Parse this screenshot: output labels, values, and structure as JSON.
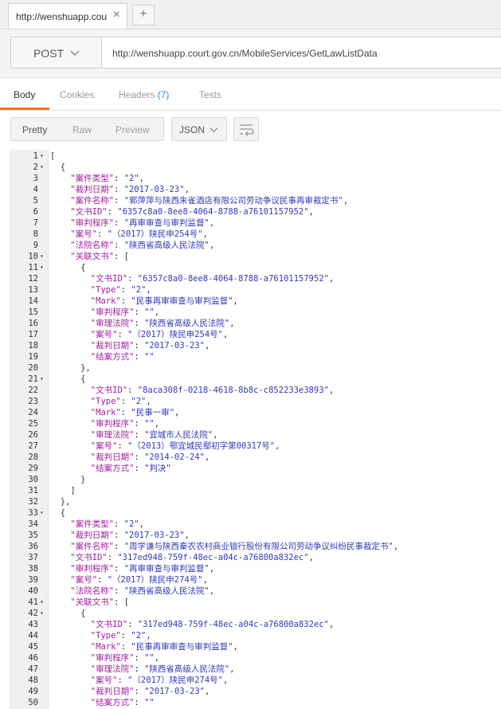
{
  "tab": {
    "title": "http://wenshuapp.court.gov.cn/MobileServices/GetLawListData",
    "close": "×",
    "new": "+"
  },
  "request": {
    "method": "POST",
    "url": "http://wenshuapp.court.gov.cn/MobileServices/GetLawListData"
  },
  "response_tabs": [
    {
      "label": "Body",
      "count": "",
      "active": true
    },
    {
      "label": "Cookies",
      "count": "",
      "active": false
    },
    {
      "label": "Headers",
      "count": "(7)",
      "active": false
    },
    {
      "label": "Tests",
      "count": "",
      "active": false
    }
  ],
  "view_modes": [
    "Pretty",
    "Raw",
    "Preview"
  ],
  "format": "JSON",
  "colors": {
    "key": "#a01fa0",
    "string": "#2f3bb8",
    "accent": "#f47023",
    "count": "#2a86d9"
  },
  "lines": [
    {
      "n": "1",
      "fold": true,
      "indent": 0,
      "pre": "[",
      "key": "",
      "mid": "",
      "val": "",
      "post": ""
    },
    {
      "n": "2",
      "fold": true,
      "indent": 2,
      "pre": "{",
      "key": "",
      "mid": "",
      "val": "",
      "post": ""
    },
    {
      "n": "3",
      "fold": false,
      "indent": 4,
      "pre": "",
      "key": "\"案件类型\"",
      "mid": ": ",
      "val": "\"2\"",
      "post": ","
    },
    {
      "n": "4",
      "fold": false,
      "indent": 4,
      "pre": "",
      "key": "\"裁判日期\"",
      "mid": ": ",
      "val": "\"2017-03-23\"",
      "post": ","
    },
    {
      "n": "5",
      "fold": false,
      "indent": 4,
      "pre": "",
      "key": "\"案件名称\"",
      "mid": ": ",
      "val": "\"郭萍萍与陕西朱雀酒店有限公司劳动争议民事再审裁定书\"",
      "post": ","
    },
    {
      "n": "6",
      "fold": false,
      "indent": 4,
      "pre": "",
      "key": "\"文书ID\"",
      "mid": ": ",
      "val": "\"6357c8a0-8ee8-4064-8788-a76101157952\"",
      "post": ","
    },
    {
      "n": "7",
      "fold": false,
      "indent": 4,
      "pre": "",
      "key": "\"审判程序\"",
      "mid": ": ",
      "val": "\"再审审查与审判监督\"",
      "post": ","
    },
    {
      "n": "8",
      "fold": false,
      "indent": 4,
      "pre": "",
      "key": "\"案号\"",
      "mid": ": ",
      "val": "\"（2017）陕民申254号\"",
      "post": ","
    },
    {
      "n": "9",
      "fold": false,
      "indent": 4,
      "pre": "",
      "key": "\"法院名称\"",
      "mid": ": ",
      "val": "\"陕西省高级人民法院\"",
      "post": ","
    },
    {
      "n": "10",
      "fold": true,
      "indent": 4,
      "pre": "",
      "key": "\"关联文书\"",
      "mid": ": [",
      "val": "",
      "post": ""
    },
    {
      "n": "11",
      "fold": true,
      "indent": 6,
      "pre": "{",
      "key": "",
      "mid": "",
      "val": "",
      "post": ""
    },
    {
      "n": "12",
      "fold": false,
      "indent": 8,
      "pre": "",
      "key": "\"文书ID\"",
      "mid": ": ",
      "val": "\"6357c8a0-8ee8-4064-8788-a76101157952\"",
      "post": ","
    },
    {
      "n": "13",
      "fold": false,
      "indent": 8,
      "pre": "",
      "key": "\"Type\"",
      "mid": ": ",
      "val": "\"2\"",
      "post": ","
    },
    {
      "n": "14",
      "fold": false,
      "indent": 8,
      "pre": "",
      "key": "\"Mark\"",
      "mid": ": ",
      "val": "\"民事再审审查与审判监督\"",
      "post": ","
    },
    {
      "n": "15",
      "fold": false,
      "indent": 8,
      "pre": "",
      "key": "\"审判程序\"",
      "mid": ": ",
      "val": "\"\"",
      "post": ","
    },
    {
      "n": "16",
      "fold": false,
      "indent": 8,
      "pre": "",
      "key": "\"审理法院\"",
      "mid": ": ",
      "val": "\"陕西省高级人民法院\"",
      "post": ","
    },
    {
      "n": "17",
      "fold": false,
      "indent": 8,
      "pre": "",
      "key": "\"案号\"",
      "mid": ": ",
      "val": "\"（2017）陕民申254号\"",
      "post": ","
    },
    {
      "n": "18",
      "fold": false,
      "indent": 8,
      "pre": "",
      "key": "\"裁判日期\"",
      "mid": ": ",
      "val": "\"2017-03-23\"",
      "post": ","
    },
    {
      "n": "19",
      "fold": false,
      "indent": 8,
      "pre": "",
      "key": "\"结案方式\"",
      "mid": ": ",
      "val": "\"\"",
      "post": ""
    },
    {
      "n": "20",
      "fold": false,
      "indent": 6,
      "pre": "},",
      "key": "",
      "mid": "",
      "val": "",
      "post": ""
    },
    {
      "n": "21",
      "fold": true,
      "indent": 6,
      "pre": "{",
      "key": "",
      "mid": "",
      "val": "",
      "post": ""
    },
    {
      "n": "22",
      "fold": false,
      "indent": 8,
      "pre": "",
      "key": "\"文书ID\"",
      "mid": ": ",
      "val": "\"8aca308f-0218-4618-8b8c-c852233e3893\"",
      "post": ","
    },
    {
      "n": "23",
      "fold": false,
      "indent": 8,
      "pre": "",
      "key": "\"Type\"",
      "mid": ": ",
      "val": "\"2\"",
      "post": ","
    },
    {
      "n": "24",
      "fold": false,
      "indent": 8,
      "pre": "",
      "key": "\"Mark\"",
      "mid": ": ",
      "val": "\"民事一审\"",
      "post": ","
    },
    {
      "n": "25",
      "fold": false,
      "indent": 8,
      "pre": "",
      "key": "\"审判程序\"",
      "mid": ": ",
      "val": "\"\"",
      "post": ","
    },
    {
      "n": "26",
      "fold": false,
      "indent": 8,
      "pre": "",
      "key": "\"审理法院\"",
      "mid": ": ",
      "val": "\"宜城市人民法院\"",
      "post": ","
    },
    {
      "n": "27",
      "fold": false,
      "indent": 8,
      "pre": "",
      "key": "\"案号\"",
      "mid": ": ",
      "val": "\"（2013）鄂宜城民鄢初字第00317号\"",
      "post": ","
    },
    {
      "n": "28",
      "fold": false,
      "indent": 8,
      "pre": "",
      "key": "\"裁判日期\"",
      "mid": ": ",
      "val": "\"2014-02-24\"",
      "post": ","
    },
    {
      "n": "29",
      "fold": false,
      "indent": 8,
      "pre": "",
      "key": "\"结案方式\"",
      "mid": ": ",
      "val": "\"判决\"",
      "post": ""
    },
    {
      "n": "30",
      "fold": false,
      "indent": 6,
      "pre": "}",
      "key": "",
      "mid": "",
      "val": "",
      "post": ""
    },
    {
      "n": "31",
      "fold": false,
      "indent": 4,
      "pre": "]",
      "key": "",
      "mid": "",
      "val": "",
      "post": ""
    },
    {
      "n": "32",
      "fold": false,
      "indent": 2,
      "pre": "},",
      "key": "",
      "mid": "",
      "val": "",
      "post": ""
    },
    {
      "n": "33",
      "fold": true,
      "indent": 2,
      "pre": "{",
      "key": "",
      "mid": "",
      "val": "",
      "post": ""
    },
    {
      "n": "34",
      "fold": false,
      "indent": 4,
      "pre": "",
      "key": "\"案件类型\"",
      "mid": ": ",
      "val": "\"2\"",
      "post": ","
    },
    {
      "n": "35",
      "fold": false,
      "indent": 4,
      "pre": "",
      "key": "\"裁判日期\"",
      "mid": ": ",
      "val": "\"2017-03-23\"",
      "post": ","
    },
    {
      "n": "36",
      "fold": false,
      "indent": 4,
      "pre": "",
      "key": "\"案件名称\"",
      "mid": ": ",
      "val": "\"周学谦与陕西秦农农村商业银行股份有限公司劳动争议纠纷民事裁定书\"",
      "post": ","
    },
    {
      "n": "37",
      "fold": false,
      "indent": 4,
      "pre": "",
      "key": "\"文书ID\"",
      "mid": ": ",
      "val": "\"317ed948-759f-48ec-a04c-a76800a832ec\"",
      "post": ","
    },
    {
      "n": "38",
      "fold": false,
      "indent": 4,
      "pre": "",
      "key": "\"审判程序\"",
      "mid": ": ",
      "val": "\"再审审查与审判监督\"",
      "post": ","
    },
    {
      "n": "39",
      "fold": false,
      "indent": 4,
      "pre": "",
      "key": "\"案号\"",
      "mid": ": ",
      "val": "\"（2017）陕民申274号\"",
      "post": ","
    },
    {
      "n": "40",
      "fold": false,
      "indent": 4,
      "pre": "",
      "key": "\"法院名称\"",
      "mid": ": ",
      "val": "\"陕西省高级人民法院\"",
      "post": ","
    },
    {
      "n": "41",
      "fold": true,
      "indent": 4,
      "pre": "",
      "key": "\"关联文书\"",
      "mid": ": [",
      "val": "",
      "post": ""
    },
    {
      "n": "42",
      "fold": true,
      "indent": 6,
      "pre": "{",
      "key": "",
      "mid": "",
      "val": "",
      "post": ""
    },
    {
      "n": "43",
      "fold": false,
      "indent": 8,
      "pre": "",
      "key": "\"文书ID\"",
      "mid": ": ",
      "val": "\"317ed948-759f-48ec-a04c-a76800a832ec\"",
      "post": ","
    },
    {
      "n": "44",
      "fold": false,
      "indent": 8,
      "pre": "",
      "key": "\"Type\"",
      "mid": ": ",
      "val": "\"2\"",
      "post": ","
    },
    {
      "n": "45",
      "fold": false,
      "indent": 8,
      "pre": "",
      "key": "\"Mark\"",
      "mid": ": ",
      "val": "\"民事再审审查与审判监督\"",
      "post": ","
    },
    {
      "n": "46",
      "fold": false,
      "indent": 8,
      "pre": "",
      "key": "\"审判程序\"",
      "mid": ": ",
      "val": "\"\"",
      "post": ","
    },
    {
      "n": "47",
      "fold": false,
      "indent": 8,
      "pre": "",
      "key": "\"审理法院\"",
      "mid": ": ",
      "val": "\"陕西省高级人民法院\"",
      "post": ","
    },
    {
      "n": "48",
      "fold": false,
      "indent": 8,
      "pre": "",
      "key": "\"案号\"",
      "mid": ": ",
      "val": "\"（2017）陕民申274号\"",
      "post": ","
    },
    {
      "n": "49",
      "fold": false,
      "indent": 8,
      "pre": "",
      "key": "\"裁判日期\"",
      "mid": ": ",
      "val": "\"2017-03-23\"",
      "post": ","
    },
    {
      "n": "50",
      "fold": false,
      "indent": 8,
      "pre": "",
      "key": "\"结案方式\"",
      "mid": ": ",
      "val": "\"\"",
      "post": ""
    }
  ]
}
